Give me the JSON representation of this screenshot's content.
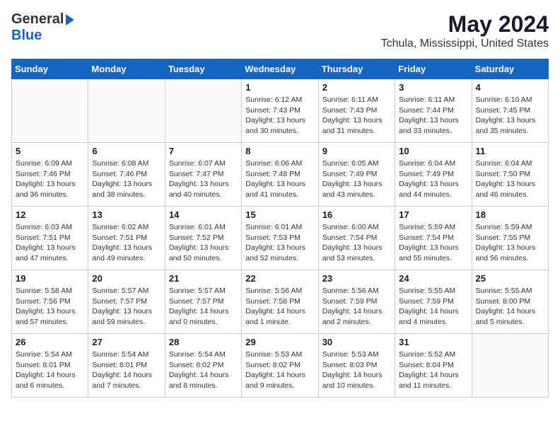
{
  "header": {
    "logo_general": "General",
    "logo_blue": "Blue",
    "month_title": "May 2024",
    "location": "Tchula, Mississippi, United States"
  },
  "weekdays": [
    "Sunday",
    "Monday",
    "Tuesday",
    "Wednesday",
    "Thursday",
    "Friday",
    "Saturday"
  ],
  "weeks": [
    [
      {
        "day": "",
        "text": ""
      },
      {
        "day": "",
        "text": ""
      },
      {
        "day": "",
        "text": ""
      },
      {
        "day": "1",
        "text": "Sunrise: 6:12 AM\nSunset: 7:43 PM\nDaylight: 13 hours\nand 30 minutes."
      },
      {
        "day": "2",
        "text": "Sunrise: 6:11 AM\nSunset: 7:43 PM\nDaylight: 13 hours\nand 31 minutes."
      },
      {
        "day": "3",
        "text": "Sunrise: 6:11 AM\nSunset: 7:44 PM\nDaylight: 13 hours\nand 33 minutes."
      },
      {
        "day": "4",
        "text": "Sunrise: 6:10 AM\nSunset: 7:45 PM\nDaylight: 13 hours\nand 35 minutes."
      }
    ],
    [
      {
        "day": "5",
        "text": "Sunrise: 6:09 AM\nSunset: 7:46 PM\nDaylight: 13 hours\nand 36 minutes."
      },
      {
        "day": "6",
        "text": "Sunrise: 6:08 AM\nSunset: 7:46 PM\nDaylight: 13 hours\nand 38 minutes."
      },
      {
        "day": "7",
        "text": "Sunrise: 6:07 AM\nSunset: 7:47 PM\nDaylight: 13 hours\nand 40 minutes."
      },
      {
        "day": "8",
        "text": "Sunrise: 6:06 AM\nSunset: 7:48 PM\nDaylight: 13 hours\nand 41 minutes."
      },
      {
        "day": "9",
        "text": "Sunrise: 6:05 AM\nSunset: 7:49 PM\nDaylight: 13 hours\nand 43 minutes."
      },
      {
        "day": "10",
        "text": "Sunrise: 6:04 AM\nSunset: 7:49 PM\nDaylight: 13 hours\nand 44 minutes."
      },
      {
        "day": "11",
        "text": "Sunrise: 6:04 AM\nSunset: 7:50 PM\nDaylight: 13 hours\nand 46 minutes."
      }
    ],
    [
      {
        "day": "12",
        "text": "Sunrise: 6:03 AM\nSunset: 7:51 PM\nDaylight: 13 hours\nand 47 minutes."
      },
      {
        "day": "13",
        "text": "Sunrise: 6:02 AM\nSunset: 7:51 PM\nDaylight: 13 hours\nand 49 minutes."
      },
      {
        "day": "14",
        "text": "Sunrise: 6:01 AM\nSunset: 7:52 PM\nDaylight: 13 hours\nand 50 minutes."
      },
      {
        "day": "15",
        "text": "Sunrise: 6:01 AM\nSunset: 7:53 PM\nDaylight: 13 hours\nand 52 minutes."
      },
      {
        "day": "16",
        "text": "Sunrise: 6:00 AM\nSunset: 7:54 PM\nDaylight: 13 hours\nand 53 minutes."
      },
      {
        "day": "17",
        "text": "Sunrise: 5:59 AM\nSunset: 7:54 PM\nDaylight: 13 hours\nand 55 minutes."
      },
      {
        "day": "18",
        "text": "Sunrise: 5:59 AM\nSunset: 7:55 PM\nDaylight: 13 hours\nand 56 minutes."
      }
    ],
    [
      {
        "day": "19",
        "text": "Sunrise: 5:58 AM\nSunset: 7:56 PM\nDaylight: 13 hours\nand 57 minutes."
      },
      {
        "day": "20",
        "text": "Sunrise: 5:57 AM\nSunset: 7:57 PM\nDaylight: 13 hours\nand 59 minutes."
      },
      {
        "day": "21",
        "text": "Sunrise: 5:57 AM\nSunset: 7:57 PM\nDaylight: 14 hours\nand 0 minutes."
      },
      {
        "day": "22",
        "text": "Sunrise: 5:56 AM\nSunset: 7:58 PM\nDaylight: 14 hours\nand 1 minute."
      },
      {
        "day": "23",
        "text": "Sunrise: 5:56 AM\nSunset: 7:59 PM\nDaylight: 14 hours\nand 2 minutes."
      },
      {
        "day": "24",
        "text": "Sunrise: 5:55 AM\nSunset: 7:59 PM\nDaylight: 14 hours\nand 4 minutes."
      },
      {
        "day": "25",
        "text": "Sunrise: 5:55 AM\nSunset: 8:00 PM\nDaylight: 14 hours\nand 5 minutes."
      }
    ],
    [
      {
        "day": "26",
        "text": "Sunrise: 5:54 AM\nSunset: 8:01 PM\nDaylight: 14 hours\nand 6 minutes."
      },
      {
        "day": "27",
        "text": "Sunrise: 5:54 AM\nSunset: 8:01 PM\nDaylight: 14 hours\nand 7 minutes."
      },
      {
        "day": "28",
        "text": "Sunrise: 5:54 AM\nSunset: 8:02 PM\nDaylight: 14 hours\nand 8 minutes."
      },
      {
        "day": "29",
        "text": "Sunrise: 5:53 AM\nSunset: 8:02 PM\nDaylight: 14 hours\nand 9 minutes."
      },
      {
        "day": "30",
        "text": "Sunrise: 5:53 AM\nSunset: 8:03 PM\nDaylight: 14 hours\nand 10 minutes."
      },
      {
        "day": "31",
        "text": "Sunrise: 5:52 AM\nSunset: 8:04 PM\nDaylight: 14 hours\nand 11 minutes."
      },
      {
        "day": "",
        "text": ""
      }
    ]
  ]
}
